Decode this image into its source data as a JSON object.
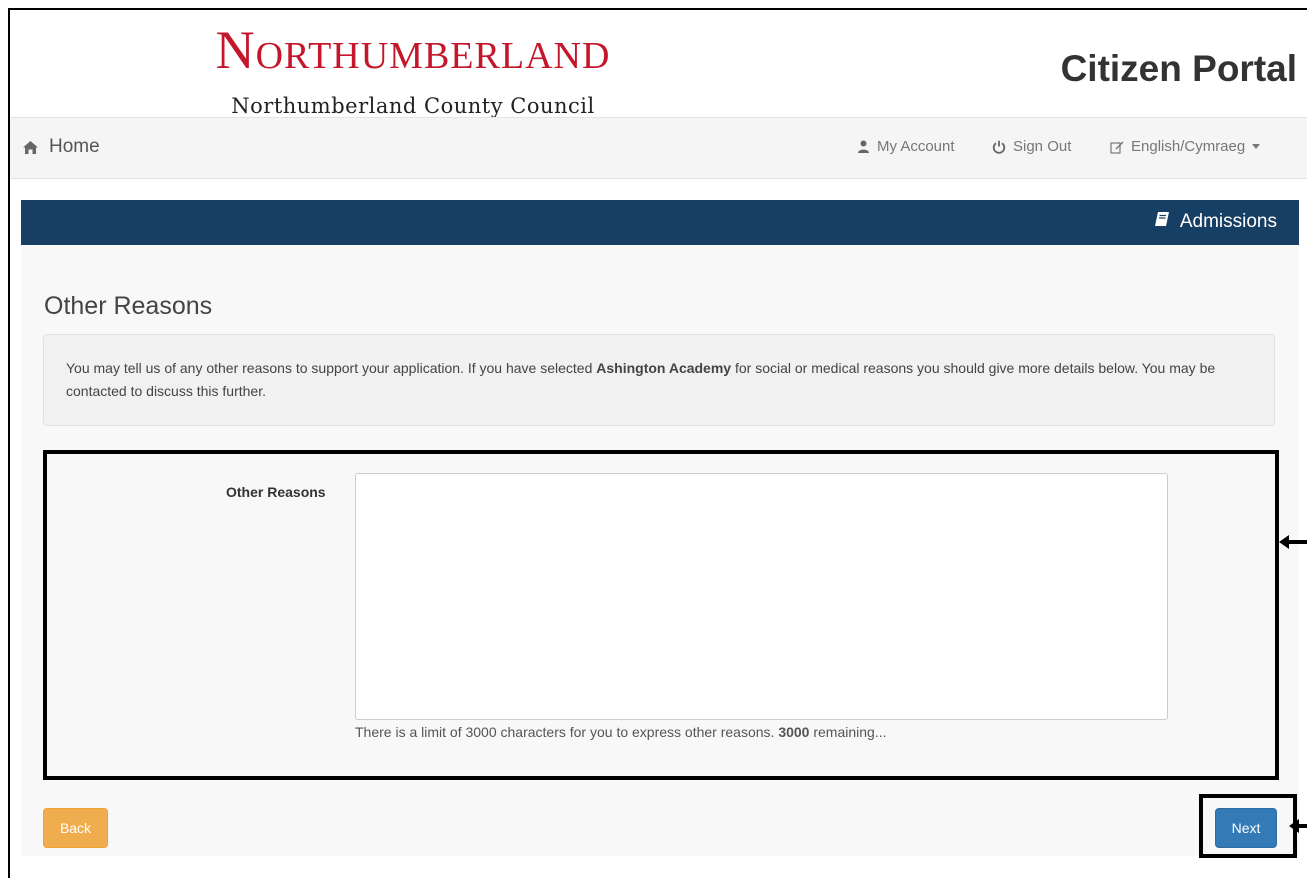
{
  "header": {
    "logo_text": "Northumberland",
    "logo_subtitle": "Northumberland County Council",
    "portal_title": "Citizen Portal"
  },
  "nav": {
    "home_label": "Home",
    "home_icon": "home-icon",
    "account_label": "My Account",
    "account_icon": "user-icon",
    "signout_label": "Sign Out",
    "signout_icon": "power-icon",
    "language_label": "English/Cymraeg",
    "language_icon": "edit-icon"
  },
  "section": {
    "label": "Admissions",
    "icon": "book-icon",
    "bar_color": "#173e63"
  },
  "main": {
    "title": "Other Reasons",
    "info_before": "You may tell us of any other reasons to support your application. If you have selected ",
    "info_bold": "Ashington Academy",
    "info_after": " for social or medical reasons you should give more details below. You may be contacted to discuss this further.",
    "field_label": "Other Reasons",
    "field_value": "",
    "help_before": "There is a limit of 3000 characters for you to express other reasons. ",
    "help_count": "3000",
    "help_after": " remaining..."
  },
  "buttons": {
    "back_label": "Back",
    "next_label": "Next",
    "back_color": "#f0ad4e",
    "next_color": "#337ab7"
  },
  "brand_color": "#c4172c"
}
